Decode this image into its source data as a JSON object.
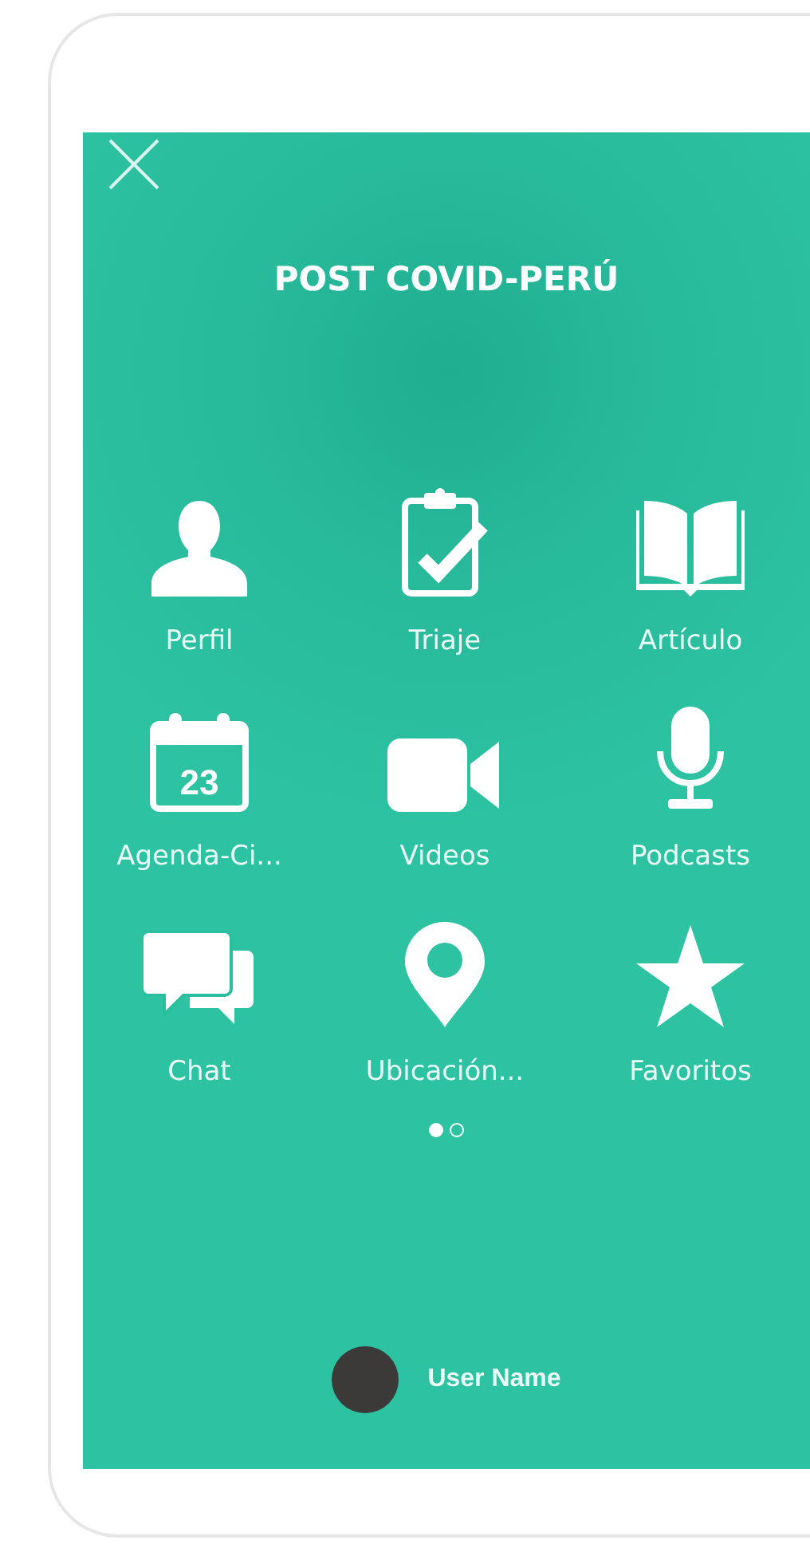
{
  "title": "POST COVID-PERÚ",
  "items": [
    {
      "kind": "person",
      "label": "Perfil"
    },
    {
      "kind": "clipboard",
      "label": "Triaje"
    },
    {
      "kind": "book",
      "label": "Artículo"
    },
    {
      "kind": "calendar",
      "label": "Agenda-Ci...",
      "day": "23"
    },
    {
      "kind": "video",
      "label": "Videos"
    },
    {
      "kind": "microphone",
      "label": "Podcasts"
    },
    {
      "kind": "chat",
      "label": "Chat"
    },
    {
      "kind": "pin",
      "label": "Ubicación..."
    },
    {
      "kind": "star",
      "label": "Favoritos"
    }
  ],
  "pages": [
    {
      "selected": true
    },
    {
      "selected": false
    }
  ],
  "user": {
    "name": "User Name"
  }
}
